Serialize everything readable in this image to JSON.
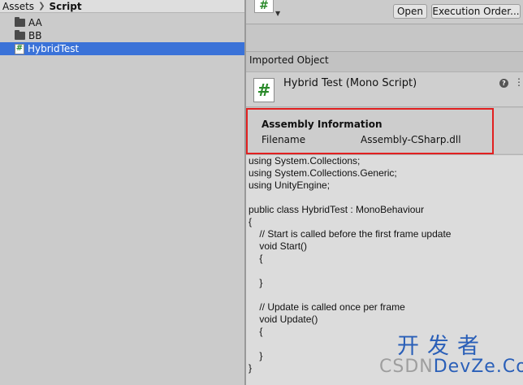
{
  "project": {
    "breadcrumb": [
      "Assets",
      "Script"
    ],
    "items": [
      {
        "label": "AA",
        "type": "folder",
        "selected": false
      },
      {
        "label": "BB",
        "type": "folder",
        "selected": false
      },
      {
        "label": "HybridTest",
        "type": "script",
        "selected": true
      }
    ]
  },
  "inspector": {
    "buttons": {
      "open": "Open",
      "execution_order": "Execution Order..."
    },
    "section_label": "Imported Object",
    "title": "Hybrid Test (Mono Script)",
    "assembly": {
      "title": "Assembly Information",
      "filename_label": "Filename",
      "filename_value": "Assembly-CSharp.dll"
    },
    "code_lines": [
      "using System.Collections;",
      "using System.Collections.Generic;",
      "using UnityEngine;",
      "",
      "public class HybridTest : MonoBehaviour",
      "{",
      "    // Start is called before the first frame update",
      "    void Start()",
      "    {",
      "",
      "    }",
      "",
      "    // Update is called once per frame",
      "    void Update()",
      "    {",
      "",
      "    }",
      "}"
    ]
  },
  "icons": {
    "script_glyph": "#",
    "help_glyph": "?",
    "menu_glyph": "⋮",
    "caret_glyph": "▼",
    "crumb_sep": "❯"
  },
  "watermark": {
    "cn": "开发者",
    "en_prefix": "CSDN",
    "en": "DevZe.CoM"
  },
  "colors": {
    "selection": "#3a72d8",
    "highlight_box": "#e12020",
    "watermark": "#2a5fb8"
  }
}
